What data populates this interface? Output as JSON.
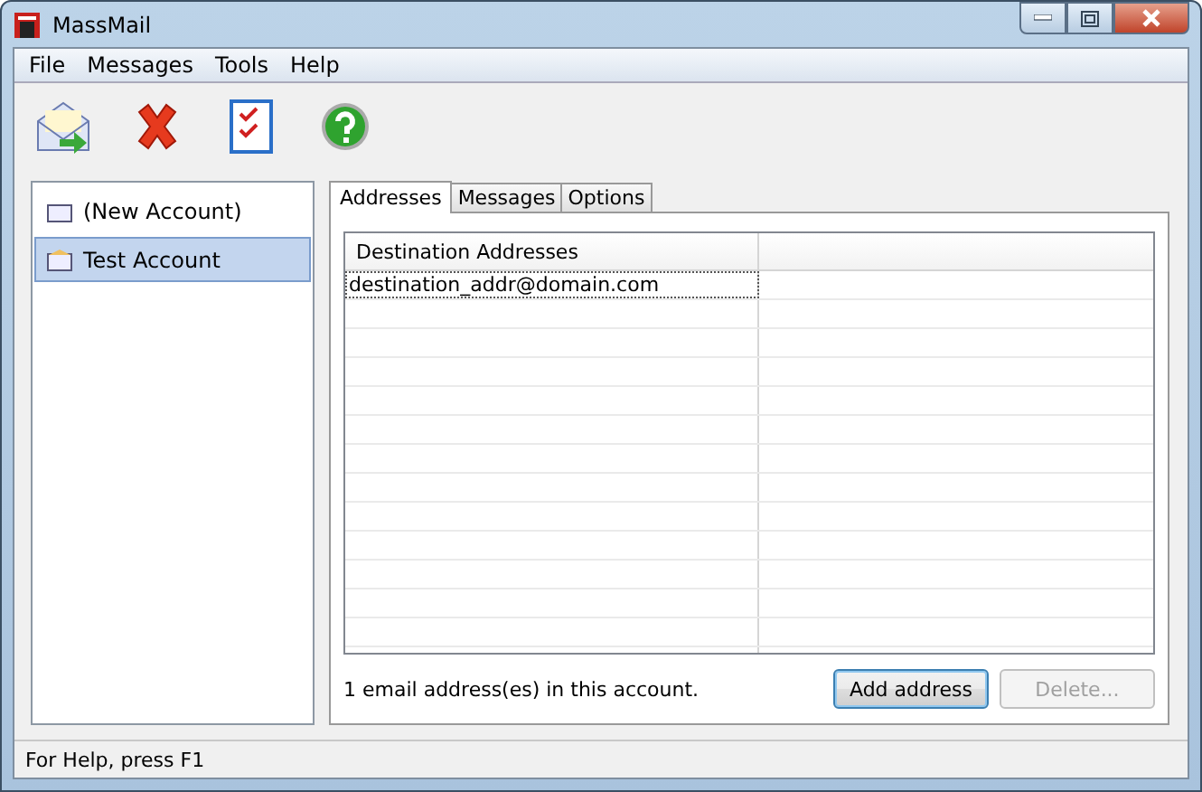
{
  "window": {
    "title": "MassMail"
  },
  "menu": [
    "File",
    "Messages",
    "Tools",
    "Help"
  ],
  "accounts": [
    {
      "name": "(New Account)",
      "selected": false
    },
    {
      "name": "Test Account",
      "selected": true
    }
  ],
  "tabs": [
    {
      "label": "Addresses",
      "selected": true
    },
    {
      "label": "Messages",
      "selected": false
    },
    {
      "label": "Options",
      "selected": false
    }
  ],
  "table": {
    "columns": [
      "Destination Addresses"
    ],
    "rows": [
      {
        "address": "destination_addr@domain.com",
        "focused": true
      }
    ]
  },
  "count_text": "1 email address(es) in this account.",
  "buttons": [
    {
      "label": "Add address",
      "disabled": false,
      "default": true
    },
    {
      "label": "Delete...",
      "disabled": true,
      "default": false
    }
  ],
  "status_bar": "For Help, press F1"
}
